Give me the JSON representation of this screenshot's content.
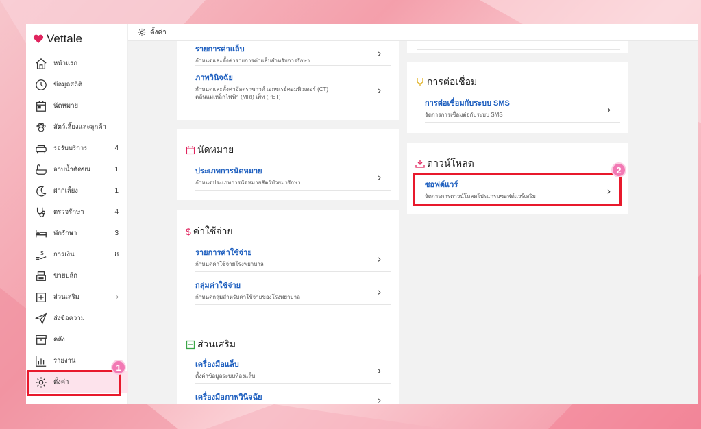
{
  "app": {
    "name": "Vettale",
    "brand_color": "#e0245e",
    "link_color": "#1e5fbf",
    "highlight_color": "#e8192c"
  },
  "topbar": {
    "title": "ตั้งค่า",
    "icon": "gear-icon"
  },
  "sidebar": {
    "items": [
      {
        "label": "หน้าแรก",
        "icon": "home-icon",
        "count": ""
      },
      {
        "label": "ข้อมูลสถิติ",
        "icon": "dashboard-icon",
        "count": ""
      },
      {
        "label": "นัดหมาย",
        "icon": "calendar-icon",
        "count": ""
      },
      {
        "label": "สัตว์เลี้ยงและลูกค้า",
        "icon": "paw-icon",
        "count": ""
      },
      {
        "label": "รอรับบริการ",
        "icon": "sofa-icon",
        "count": "4"
      },
      {
        "label": "อาบน้ำตัดขน",
        "icon": "bathtub-icon",
        "count": "1"
      },
      {
        "label": "ฝากเลี้ยง",
        "icon": "moon-icon",
        "count": "1"
      },
      {
        "label": "ตรวจรักษา",
        "icon": "stethoscope-icon",
        "count": "4"
      },
      {
        "label": "พักรักษา",
        "icon": "bed-icon",
        "count": "3"
      },
      {
        "label": "การเงิน",
        "icon": "money-hand-icon",
        "count": "8"
      },
      {
        "label": "ขายปลีก",
        "icon": "cash-register-icon",
        "count": ""
      },
      {
        "label": "ส่วนเสริม",
        "icon": "plus-square-icon",
        "count": "",
        "chevron": "›"
      },
      {
        "label": "ส่งข้อความ",
        "icon": "send-icon",
        "count": ""
      },
      {
        "label": "คลัง",
        "icon": "archive-icon",
        "count": ""
      },
      {
        "label": "รายงาน",
        "icon": "bar-chart-icon",
        "count": ""
      },
      {
        "label": "ตั้งค่า",
        "icon": "gear-icon",
        "count": "",
        "active": true
      }
    ]
  },
  "cards": {
    "treatment_partial": {
      "rows": [
        {
          "title": "รายการค่าแล็บ",
          "subtitle": "กำหนดและตั้งค่ารายการค่าแล็บสำหรับการรักษา"
        },
        {
          "title": "ภาพวินิจฉัย",
          "subtitle": "กำหนดและตั้งค่าอัลตราซาวด์ เอกซเรย์คอมพิวเตอร์ (CT)",
          "subtitle2": "คลื่นแม่เหล็กไฟฟ้า (MRI) เพ็ท (PET)"
        }
      ]
    },
    "appointment": {
      "title": "นัดหมาย",
      "rows": [
        {
          "title": "ประเภทการนัดหมาย",
          "subtitle": "กำหนดประเภทการนัดหมายสัตว์ป่วยมารักษา"
        }
      ]
    },
    "expense": {
      "title": "ค่าใช้จ่าย",
      "icon_glyph": "$",
      "rows": [
        {
          "title": "รายการค่าใช้จ่าย",
          "subtitle": "กำหนดค่าใช้จ่ายโรงพยาบาล"
        },
        {
          "title": "กลุ่มค่าใช้จ่าย",
          "subtitle": "กำหนดกลุ่มสำหรับค่าใช้จ่ายของโรงพยาบาล"
        }
      ]
    },
    "addons": {
      "title": "ส่วนเสริม",
      "rows": [
        {
          "title": "เครื่องมือแล็บ",
          "subtitle": "ตั้งค่าข้อมูลระบบห้องแล็บ"
        },
        {
          "title": "เครื่องมือภาพวินิจฉัย",
          "subtitle": ""
        }
      ]
    },
    "connection": {
      "title": "การต่อเชื่อม",
      "rows": [
        {
          "title": "การต่อเชื่อมกับระบบ SMS",
          "subtitle": "จัดการการเชื่อมต่อกับระบบ SMS"
        }
      ]
    },
    "download": {
      "title": "ดาวน์โหลด",
      "rows": [
        {
          "title": "ซอฟต์แวร์",
          "subtitle": "จัดการการดาวน์โหลดโปรแกรมซอฟต์แวร์เสริม"
        }
      ]
    }
  },
  "badges": {
    "one": "1",
    "two": "2"
  },
  "arrow": "›"
}
